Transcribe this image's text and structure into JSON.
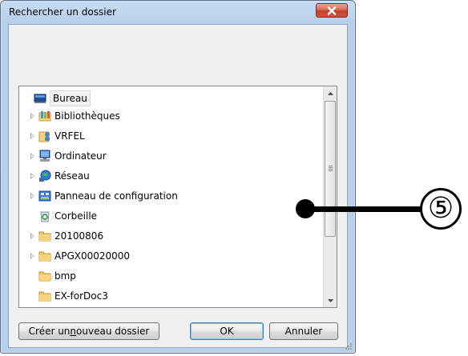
{
  "window": {
    "title": "Rechercher un dossier"
  },
  "tree": {
    "items": [
      {
        "label": "Bureau",
        "icon": "desktop-icon",
        "expandable": false,
        "selected": true,
        "level": 0
      },
      {
        "label": "Bibliothèques",
        "icon": "libraries-icon",
        "expandable": true,
        "level": 1
      },
      {
        "label": "VRFEL",
        "icon": "user-folder-icon",
        "expandable": true,
        "level": 1
      },
      {
        "label": "Ordinateur",
        "icon": "computer-icon",
        "expandable": true,
        "level": 1
      },
      {
        "label": "Réseau",
        "icon": "network-icon",
        "expandable": true,
        "level": 1
      },
      {
        "label": "Panneau de configuration",
        "icon": "control-panel-icon",
        "expandable": true,
        "level": 1
      },
      {
        "label": "Corbeille",
        "icon": "recycle-bin-icon",
        "expandable": false,
        "level": 1
      },
      {
        "label": "20100806",
        "icon": "folder-icon",
        "expandable": true,
        "level": 1
      },
      {
        "label": "APGX00020000",
        "icon": "folder-icon",
        "expandable": true,
        "level": 1
      },
      {
        "label": "bmp",
        "icon": "folder-icon",
        "expandable": false,
        "level": 1
      },
      {
        "label": "EX-forDoc3",
        "icon": "folder-icon",
        "expandable": false,
        "level": 1
      }
    ]
  },
  "buttons": {
    "new_folder_pre": "Créer un ",
    "new_folder_accel": "n",
    "new_folder_post": "ouveau dossier",
    "ok": "OK",
    "cancel": "Annuler"
  },
  "callout": {
    "number": "⑤"
  },
  "colors": {
    "titlebar": "#b9d0ea",
    "close_button": "#c4402a",
    "dialog_bg": "#f0f0f0"
  }
}
